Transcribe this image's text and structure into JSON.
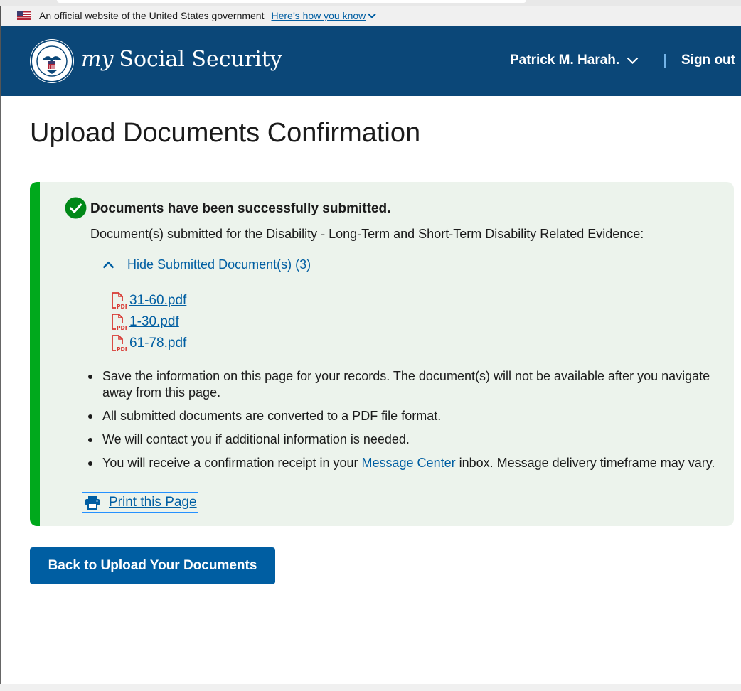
{
  "gov_banner": {
    "text": "An official website of the United States government",
    "know_link": "Here’s how you know"
  },
  "header": {
    "brand_my": "my",
    "brand_name": "Social Security",
    "user_name": "Patrick M. Harah.",
    "sign_out": "Sign out"
  },
  "page": {
    "title": "Upload Documents Confirmation"
  },
  "alert": {
    "heading": "Documents have been successfully submitted.",
    "subtext": "Document(s) submitted for the Disability - Long-Term and Short-Term Disability Related Evidence:",
    "toggle_label": "Hide Submitted Document(s) (3)",
    "documents": [
      "31-60.pdf",
      "1-30.pdf",
      "61-78.pdf"
    ],
    "notes": [
      "Save the information on this page for your records. The document(s) will not be available after you navigate away from this page.",
      "All submitted documents are converted to a PDF file format.",
      "We will contact you if additional information is needed."
    ],
    "note4_prefix": "You will receive a confirmation receipt in your ",
    "note4_link": "Message Center",
    "note4_suffix": " inbox. Message delivery timeframe may vary.",
    "print_label": "Print this Page"
  },
  "actions": {
    "back_label": "Back to Upload Your Documents"
  },
  "colors": {
    "header_bg": "#0b4778",
    "alert_bg": "#ecf3ec",
    "alert_border": "#00a91c",
    "link": "#005ea2",
    "pdf_icon": "#d83933",
    "primary_button": "#005ea2"
  },
  "icons": {
    "flag": "us-flag-icon",
    "chevron": "chevron-down-icon",
    "seal": "ssa-seal-icon",
    "success": "check-circle-icon",
    "toggle": "chevron-up-icon",
    "pdf": "pdf-file-icon",
    "print": "printer-icon"
  }
}
